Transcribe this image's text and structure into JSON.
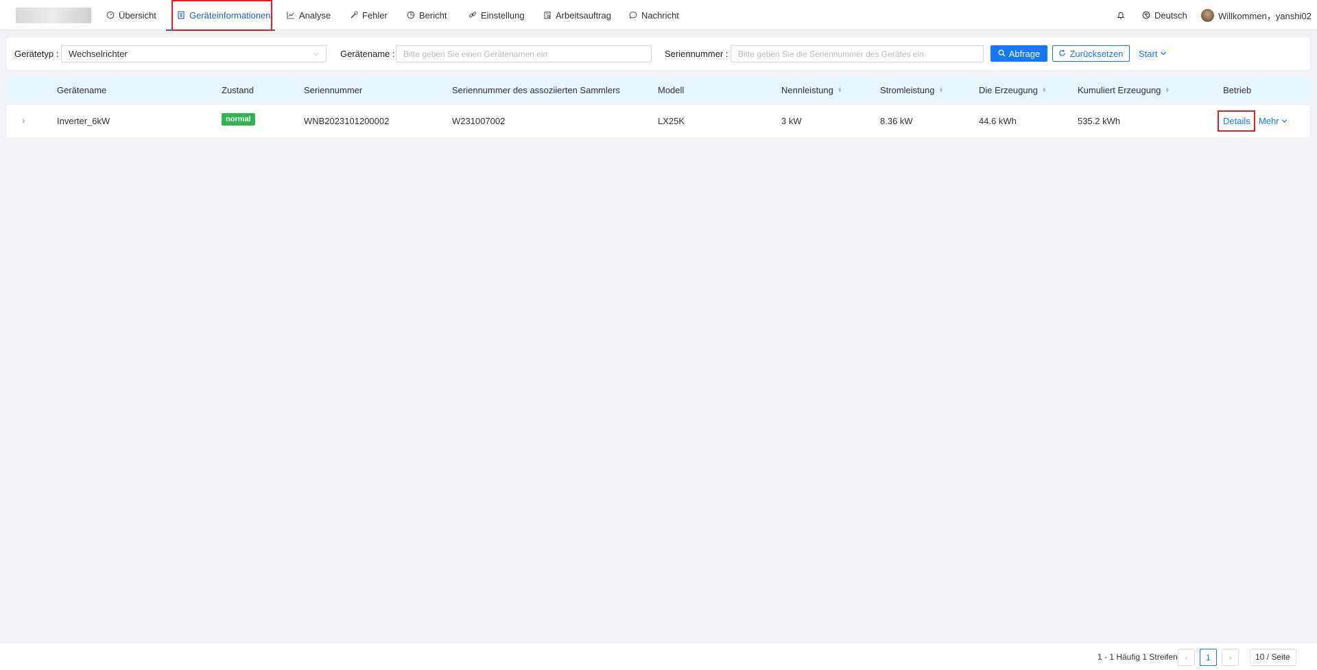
{
  "nav": {
    "items": [
      {
        "label": "Übersicht",
        "icon": "dashboard-icon"
      },
      {
        "label": "Geräteinformationen",
        "icon": "document-icon"
      },
      {
        "label": "Analyse",
        "icon": "line-chart-icon"
      },
      {
        "label": "Fehler",
        "icon": "wrench-icon"
      },
      {
        "label": "Bericht",
        "icon": "pie-chart-icon"
      },
      {
        "label": "Einstellung",
        "icon": "link-icon"
      },
      {
        "label": "Arbeitsauftrag",
        "icon": "clipboard-icon"
      },
      {
        "label": "Nachricht",
        "icon": "chat-bubble-icon"
      }
    ],
    "active": "Geräteinformationen",
    "language": "Deutsch",
    "welcome": "Willkommen，yanshi02"
  },
  "filter": {
    "device_type_label": "Gerätetyp :",
    "device_type_value": "Wechselrichter",
    "device_name_label": "Gerätename :",
    "device_name_placeholder": "Bitte geben Sie einen Gerätenamen ein",
    "serial_label": "Seriennummer :",
    "serial_placeholder": "Bitte geben Sie die Seriennummer des Gerätes ein",
    "query_button": "Abfrage",
    "reset_button": "Zurücksetzen",
    "start_link": "Start"
  },
  "table": {
    "headers": {
      "name": "Gerätename",
      "state": "Zustand",
      "serial": "Seriennummer",
      "collector_serial": "Seriennummer des assoziierten Sammlers",
      "model": "Modell",
      "rated_power": "Nennleistung",
      "current_power": "Stromleistung",
      "generation": "Die Erzeugung",
      "cumulative": "Kumuliert Erzeugung",
      "operation": "Betrieb"
    },
    "rows": [
      {
        "name": "Inverter_6kW",
        "state": "normal",
        "serial": "WNB2023101200002",
        "collector_serial": "W231007002",
        "model": "LX25K",
        "rated_power": "3 kW",
        "current_power": "8.36 kW",
        "generation": "44.6 kWh",
        "cumulative": "535.2 kWh",
        "details": "Details",
        "more": "Mehr"
      }
    ]
  },
  "pagination": {
    "summary": "1 - 1 Häufig 1 Streifen",
    "current_page": "1",
    "page_size": "10 / Seite"
  },
  "colors": {
    "primary": "#1677ff",
    "status_normal": "#2fb54e",
    "highlight": "#e02020"
  }
}
